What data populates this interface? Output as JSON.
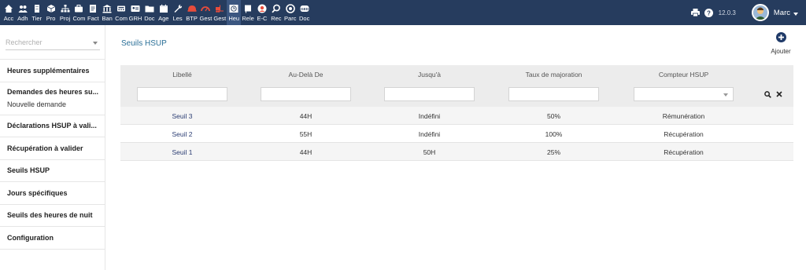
{
  "topbar": {
    "modules": [
      {
        "label": "Acc",
        "icon": "home-icon",
        "active": false
      },
      {
        "label": "Adh",
        "icon": "users-icon",
        "active": false
      },
      {
        "label": "Tier",
        "icon": "building-icon",
        "active": false
      },
      {
        "label": "Pro",
        "icon": "cube-icon",
        "active": false
      },
      {
        "label": "Proj",
        "icon": "sitemap-icon",
        "active": false
      },
      {
        "label": "Com",
        "icon": "briefcase-icon",
        "active": false
      },
      {
        "label": "Fact",
        "icon": "invoice-icon",
        "active": false
      },
      {
        "label": "Ban",
        "icon": "bank-icon",
        "active": false
      },
      {
        "label": "Com",
        "icon": "calculator-icon",
        "active": false
      },
      {
        "label": "GRH",
        "icon": "id-card-icon",
        "active": false
      },
      {
        "label": "Doc",
        "icon": "folder-icon",
        "active": false
      },
      {
        "label": "Age",
        "icon": "calendar-icon",
        "active": false
      },
      {
        "label": "Les",
        "icon": "wrench-icon",
        "active": false
      },
      {
        "label": "BTP",
        "icon": "helmet-icon",
        "active": false
      },
      {
        "label": "Gest",
        "icon": "gauge-icon",
        "active": false
      },
      {
        "label": "Gest",
        "icon": "forklift-icon",
        "active": false
      },
      {
        "label": "Heu",
        "icon": "clock-list-icon",
        "active": true
      },
      {
        "label": "Rele",
        "icon": "flag-icon",
        "active": false
      },
      {
        "label": "E-C",
        "icon": "avatar-icon",
        "active": false
      },
      {
        "label": "Rec",
        "icon": "magnifier-icon",
        "active": false
      },
      {
        "label": "Parc",
        "icon": "circle-icon",
        "active": false
      },
      {
        "label": "Doc",
        "icon": "ged-icon",
        "active": false
      }
    ],
    "version": "12.0.3",
    "username": "Marc",
    "print_icon": "print-icon",
    "help_icon": "help-icon"
  },
  "sidebar": {
    "search_placeholder": "Rechercher",
    "items": [
      {
        "label": "Heures supplémentaires"
      },
      {
        "label": "Demandes des heures su...",
        "sub": "Nouvelle demande"
      },
      {
        "label": "Déclarations HSUP à vali..."
      },
      {
        "label": "Récupération à valider"
      },
      {
        "label": "Seuils HSUP"
      },
      {
        "label": "Jours spécifiques"
      },
      {
        "label": "Seuils des heures de nuit"
      },
      {
        "label": "Configuration"
      }
    ]
  },
  "main": {
    "title": "Seuils HSUP",
    "add_label": "Ajouter"
  },
  "table": {
    "columns": [
      "Libellé",
      "Au-Delà De",
      "Jusqu'à",
      "Taux de majoration",
      "Compteur HSUP"
    ],
    "rows": [
      [
        "Seuil 3",
        "44H",
        "Indéfini",
        "50%",
        "Rémunération"
      ],
      [
        "Seuil 2",
        "55H",
        "Indéfini",
        "100%",
        "Récupération"
      ],
      [
        "Seuil 1",
        "44H",
        "50H",
        "25%",
        "Récupération"
      ]
    ]
  },
  "colors": {
    "topbar": "#263c5e",
    "title": "#2a6f97",
    "link": "#2b3d73"
  }
}
